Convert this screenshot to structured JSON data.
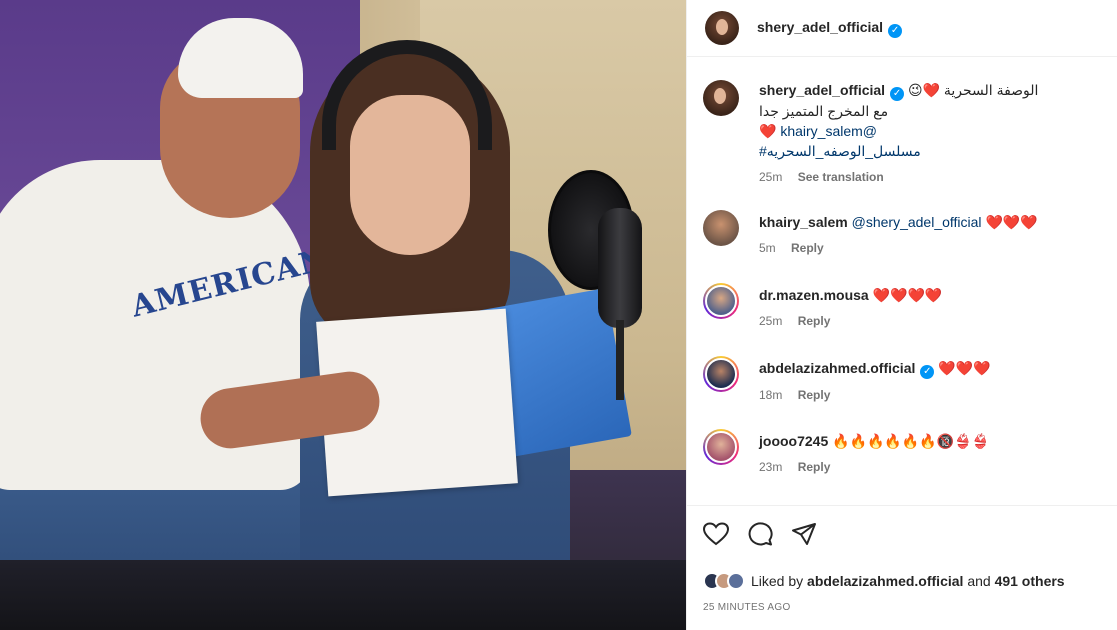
{
  "header": {
    "username": "shery_adel_official"
  },
  "caption": {
    "username": "shery_adel_official",
    "line1": "الوصفة السحرية ❤️😉",
    "line2": "مع المخرج المتميز جدا",
    "line3_heart": "❤️",
    "line3_mention": "khairy_salem@",
    "line4_hashtag": "#مسلسل_الوصفه_السحريه",
    "time": "25m",
    "translation": "See translation"
  },
  "comments": [
    {
      "username": "khairy_salem",
      "mention": "@shery_adel_official",
      "emoji": "❤️❤️❤️",
      "time": "5m",
      "reply": "Reply"
    },
    {
      "username": "dr.mazen.mousa",
      "emoji": "❤️❤️❤️❤️",
      "time": "25m",
      "reply": "Reply"
    },
    {
      "username": "abdelazizahmed.official",
      "emoji": "❤️❤️❤️",
      "time": "18m",
      "reply": "Reply"
    },
    {
      "username": "joooo7245",
      "emoji": "🔥🔥🔥🔥🔥🔥🔞👙👙",
      "time": "23m",
      "reply": "Reply"
    }
  ],
  "likes": {
    "prefix": "Liked by",
    "user": "abdelazizahmed.official",
    "joiner": "and",
    "others": "491 others"
  },
  "post_time": "25 MINUTES AGO",
  "icons": {
    "like": "heart-icon",
    "comment": "comment-icon",
    "share": "share-icon",
    "verified": "verified-badge-icon"
  }
}
